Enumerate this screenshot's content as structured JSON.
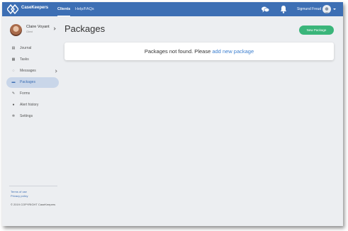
{
  "app": {
    "brand": "CaseKeepers"
  },
  "topnav": {
    "items": [
      {
        "label": "Clients",
        "active": true
      },
      {
        "label": "Help/FAQs",
        "active": false
      }
    ],
    "user_name": "Sigmund Freud",
    "icons": [
      "chat-icon",
      "bell-icon",
      "user-avatar-icon",
      "caret-down-icon"
    ]
  },
  "profile": {
    "name": "Claire Voyant",
    "role": "Client"
  },
  "sidebar": {
    "items": [
      {
        "label": "Journal",
        "icon": "journal-icon",
        "glyph": "▤"
      },
      {
        "label": "Tasks",
        "icon": "tasks-icon",
        "glyph": "▦"
      },
      {
        "label": "Messages",
        "icon": "messages-icon",
        "glyph": "◌"
      },
      {
        "label": "Packages",
        "icon": "packages-icon",
        "glyph": "▬",
        "active": true
      },
      {
        "label": "Forms",
        "icon": "forms-icon",
        "glyph": "✎"
      },
      {
        "label": "Alert history",
        "icon": "alert-icon",
        "glyph": "●"
      },
      {
        "label": "Settings",
        "icon": "settings-icon",
        "glyph": "✲"
      }
    ],
    "footer": {
      "terms": "Terms of use",
      "privacy": "Privacy policy",
      "copyright": "© 2019 COPYRIGHT CaseKeepers"
    }
  },
  "main": {
    "title": "Packages",
    "new_button": "New Package",
    "notice_text": "Packages not found. Please",
    "notice_link": "add new package"
  },
  "colors": {
    "topbar": "#3d6fb4",
    "accent_green": "#3ab57a",
    "link": "#3d7fcf",
    "active_bg": "#c9d6e9"
  }
}
